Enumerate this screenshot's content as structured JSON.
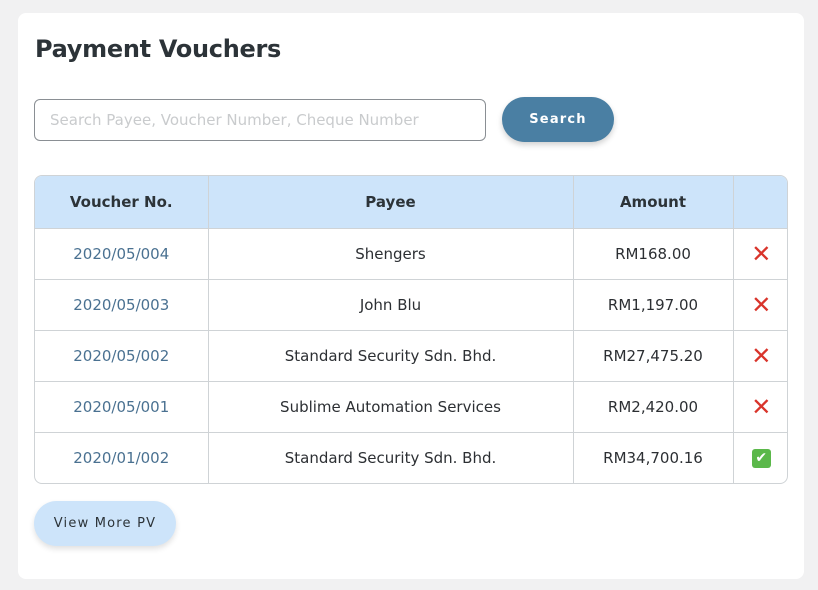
{
  "page": {
    "title": "Payment Vouchers"
  },
  "search": {
    "placeholder": "Search Payee, Voucher Number, Cheque Number",
    "value": "",
    "button_label": "Search"
  },
  "table": {
    "headers": {
      "voucher": "Voucher No.",
      "payee": "Payee",
      "amount": "Amount",
      "status": ""
    },
    "rows": [
      {
        "voucher": "2020/05/004",
        "payee": "Shengers",
        "amount": "RM168.00",
        "status": "cross"
      },
      {
        "voucher": "2020/05/003",
        "payee": "John Blu",
        "amount": "RM1,197.00",
        "status": "cross"
      },
      {
        "voucher": "2020/05/002",
        "payee": "Standard Security Sdn. Bhd.",
        "amount": "RM27,475.20",
        "status": "cross"
      },
      {
        "voucher": "2020/05/001",
        "payee": "Sublime Automation Services",
        "amount": "RM2,420.00",
        "status": "cross"
      },
      {
        "voucher": "2020/01/002",
        "payee": "Standard Security Sdn. Bhd.",
        "amount": "RM34,700.16",
        "status": "check"
      }
    ],
    "status_icons": {
      "cross": "❌",
      "check": "✔"
    }
  },
  "footer": {
    "view_more_label": "View More PV"
  },
  "colors": {
    "page_bg": "#f1f1f2",
    "card_bg": "#ffffff",
    "accent": "#4a7fa3",
    "header_bg": "#cde4fa",
    "link": "#4a7191",
    "cross": "#d9342b",
    "check": "#5bb84a"
  }
}
